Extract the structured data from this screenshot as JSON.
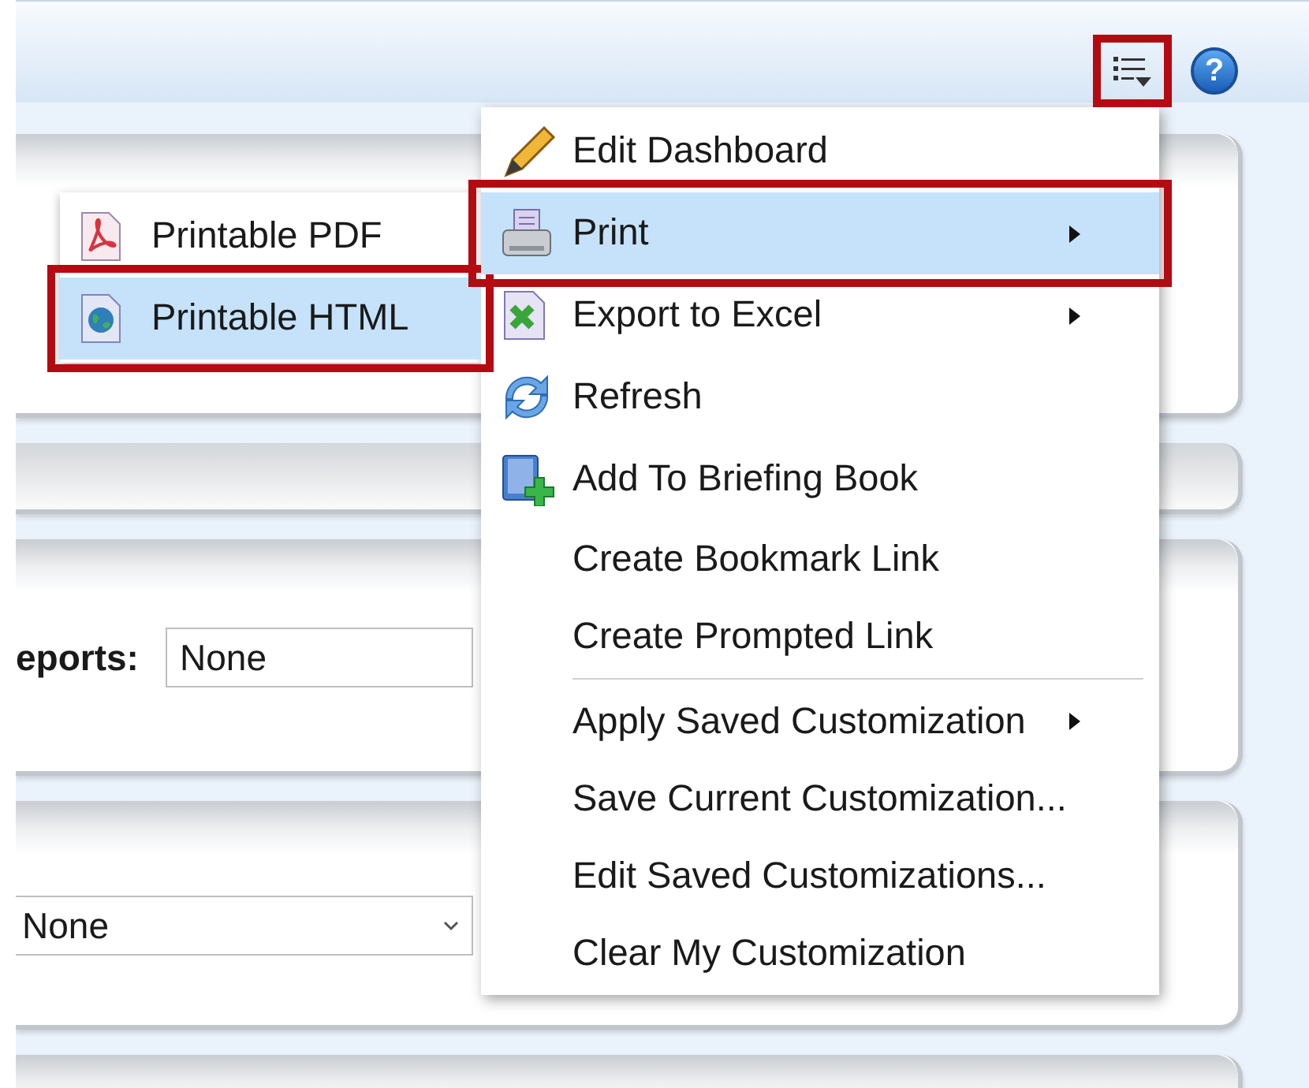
{
  "toolbar": [
    {
      "kind": "page-options",
      "outlined": true
    },
    {
      "kind": "help",
      "label": "?",
      "outlined": false
    }
  ],
  "panels": [
    {
      "kind": "plain"
    },
    {
      "kind": "thin"
    },
    {
      "kind": "labeled-field",
      "label": "eports:",
      "value": "None"
    },
    {
      "kind": "select",
      "value": "None"
    },
    {
      "kind": "plain"
    }
  ],
  "menu": {
    "items": [
      {
        "kind": "pencil",
        "label": "Edit Dashboard",
        "submenu": false,
        "selected": false,
        "outlined": false
      },
      {
        "kind": "printer",
        "label": "Print",
        "submenu": true,
        "selected": true,
        "outlined": true
      },
      {
        "kind": "spreadsheet",
        "label": "Export to Excel",
        "submenu": true,
        "selected": false,
        "outlined": false
      },
      {
        "kind": "refresh",
        "label": "Refresh",
        "submenu": false,
        "selected": false,
        "outlined": false
      },
      {
        "kind": "book-plus",
        "label": "Add To Briefing Book",
        "submenu": false,
        "selected": false,
        "outlined": false
      },
      {
        "kind": "text",
        "label": "Create Bookmark Link",
        "submenu": false,
        "selected": false,
        "outlined": false
      },
      {
        "kind": "text",
        "label": "Create Prompted Link",
        "submenu": false,
        "selected": false,
        "outlined": false
      },
      {
        "kind": "separator"
      },
      {
        "kind": "text",
        "label": "Apply Saved Customization",
        "submenu": true,
        "selected": false,
        "outlined": false
      },
      {
        "kind": "text",
        "label": "Save Current Customization...",
        "submenu": false,
        "selected": false,
        "outlined": false
      },
      {
        "kind": "text",
        "label": "Edit Saved Customizations...",
        "submenu": false,
        "selected": false,
        "outlined": false
      },
      {
        "kind": "text",
        "label": "Clear My Customization",
        "submenu": false,
        "selected": false,
        "outlined": false
      }
    ]
  },
  "submenu": {
    "items": [
      {
        "kind": "pdf",
        "label": "Printable PDF",
        "selected": false,
        "outlined": false
      },
      {
        "kind": "globe",
        "label": "Printable HTML",
        "selected": true,
        "outlined": true
      }
    ]
  }
}
